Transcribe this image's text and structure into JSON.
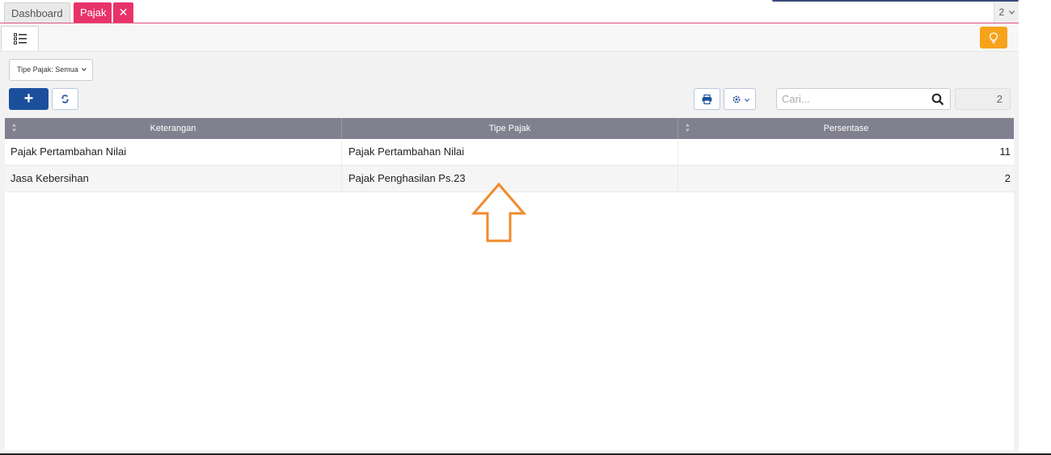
{
  "tabs": [
    {
      "label": "Dashboard",
      "active": false
    },
    {
      "label": "Pajak",
      "active": true
    }
  ],
  "tab_close_icon": "close-icon",
  "tab_counter": "2",
  "toolbar": {
    "list_icon": "list-icon",
    "hint_icon": "lightbulb-icon",
    "hint_color": "#f7a21b"
  },
  "filter": {
    "label": "Tipe Pajak: Semua"
  },
  "actions": {
    "add_label": "+",
    "add_color": "#1b4f9c",
    "refresh_icon": "refresh-icon",
    "print_icon": "print-icon",
    "settings_icon": "gear-icon"
  },
  "search": {
    "placeholder": "Cari...",
    "value": ""
  },
  "record_count": "2",
  "table": {
    "columns": [
      "Keterangan",
      "Tipe Pajak",
      "Persentase"
    ],
    "rows": [
      {
        "keterangan": "Pajak Pertambahan Nilai",
        "tipe_pajak": "Pajak Pertambahan Nilai",
        "persentase": "11"
      },
      {
        "keterangan": "Jasa Kebersihan",
        "tipe_pajak": "Pajak Penghasilan Ps.23",
        "persentase": "2"
      }
    ]
  },
  "annotation": {
    "icon": "up-arrow-annotation",
    "color": "#f08a2c"
  },
  "colors": {
    "tab_active": "#e8336a",
    "header_bg": "#80808f"
  }
}
